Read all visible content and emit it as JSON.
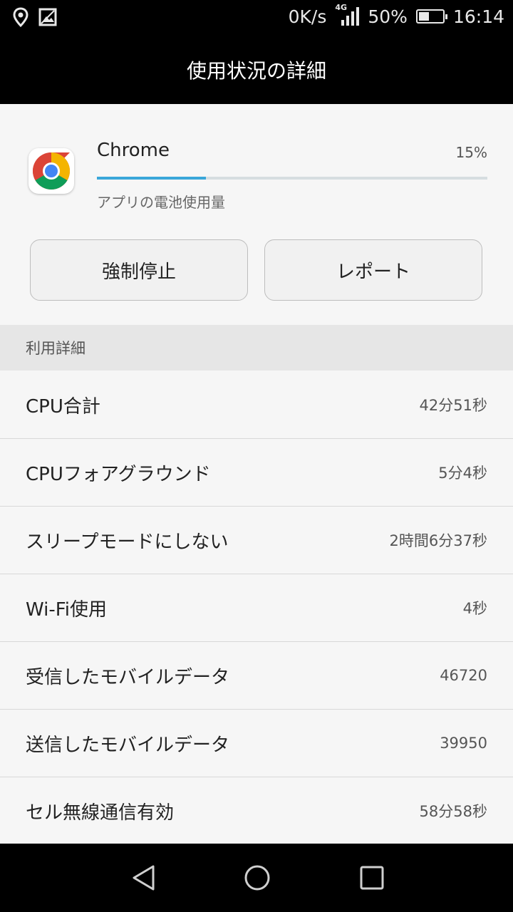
{
  "status_bar": {
    "netspeed": "0K/s",
    "network_type": "4G",
    "battery_percent": "50%",
    "battery_level": 0.5,
    "time": "16:14",
    "icons": [
      "location-icon",
      "image-icon",
      "signal-icon",
      "battery-icon"
    ]
  },
  "title_bar": {
    "title": "使用状況の詳細"
  },
  "app": {
    "name": "Chrome",
    "percent": "15%",
    "usage_fraction": 0.28,
    "subtitle": "アプリの電池使用量",
    "icon": "chrome-icon"
  },
  "buttons": {
    "force_stop": "強制停止",
    "report": "レポート"
  },
  "section": {
    "title": "利用詳細"
  },
  "details": [
    {
      "label": "CPU合計",
      "value": "42分51秒"
    },
    {
      "label": "CPUフォアグラウンド",
      "value": "5分4秒"
    },
    {
      "label": "スリープモードにしない",
      "value": "2時間6分37秒"
    },
    {
      "label": "Wi-Fi使用",
      "value": "4秒"
    },
    {
      "label": "受信したモバイルデータ",
      "value": "46720"
    },
    {
      "label": "送信したモバイルデータ",
      "value": "39950"
    },
    {
      "label": "セル無線通信有効",
      "value": "58分58秒"
    }
  ],
  "nav": {
    "icons": [
      "back-icon",
      "home-icon",
      "recents-icon"
    ]
  },
  "colors": {
    "accent": "#3aa7d9",
    "track": "#d6dde0",
    "bar": "#000000"
  }
}
